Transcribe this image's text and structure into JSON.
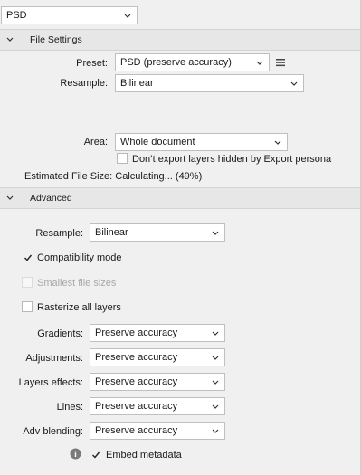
{
  "format_select": {
    "value": "PSD"
  },
  "file_settings": {
    "title": "File Settings",
    "preset": {
      "label": "Preset:",
      "value": "PSD (preserve accuracy)"
    },
    "resample": {
      "label": "Resample:",
      "value": "Bilinear"
    },
    "area": {
      "label": "Area:",
      "value": "Whole document"
    },
    "dont_export_hidden": {
      "label": "Don’t export layers hidden by Export persona",
      "checked": false
    },
    "estimated_size": "Estimated File Size: Calculating... (49%)"
  },
  "advanced": {
    "title": "Advanced",
    "resample": {
      "label": "Resample:",
      "value": "Bilinear"
    },
    "compatibility_mode": {
      "label": "Compatibility mode",
      "checked": true
    },
    "smallest_file_sizes": {
      "label": "Smallest file sizes",
      "checked": false,
      "disabled": true
    },
    "rasterize_all_layers": {
      "label": "Rasterize all layers",
      "checked": false
    },
    "gradients": {
      "label": "Gradients:",
      "value": "Preserve accuracy"
    },
    "adjustments": {
      "label": "Adjustments:",
      "value": "Preserve accuracy"
    },
    "layers_effects": {
      "label": "Layers effects:",
      "value": "Preserve accuracy"
    },
    "lines": {
      "label": "Lines:",
      "value": "Preserve accuracy"
    },
    "adv_blending": {
      "label": "Adv blending:",
      "value": "Preserve accuracy"
    },
    "embed_metadata": {
      "label": "Embed metadata",
      "checked": true
    }
  },
  "icons": {
    "chevron": "chevron-down-icon",
    "caret": "collapse-caret-icon",
    "menu": "hamburger-menu-icon",
    "info": "info-icon",
    "check": "checkmark-icon"
  }
}
